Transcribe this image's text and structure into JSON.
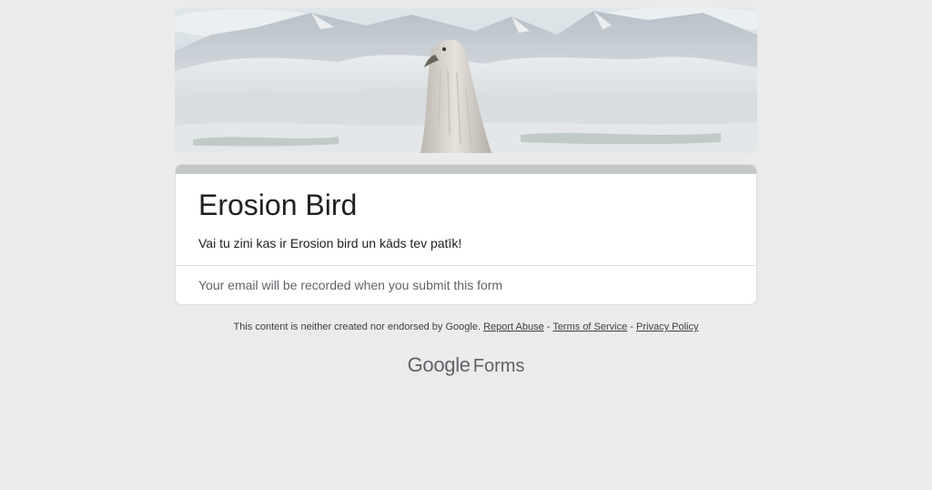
{
  "header": {
    "image_description_icon": "snowy-mountain-bird-banner"
  },
  "form": {
    "title": "Erosion Bird",
    "description": "Vai tu zini kas ir Erosion bird un kāds tev patīk!",
    "email_note": "Your email will be recorded when you submit this form"
  },
  "footer": {
    "disclaimer": "This content is neither created nor endorsed by Google.",
    "report_abuse": "Report Abuse",
    "separator": " - ",
    "terms": "Terms of Service",
    "privacy": "Privacy Policy"
  },
  "brand": {
    "google": "Google",
    "forms": "Forms"
  },
  "colors": {
    "page_bg": "#ebebeb",
    "accent_bar": "#c3c7c6",
    "card_bg": "#ffffff",
    "text_primary": "#202124",
    "text_secondary": "#5f6368"
  }
}
